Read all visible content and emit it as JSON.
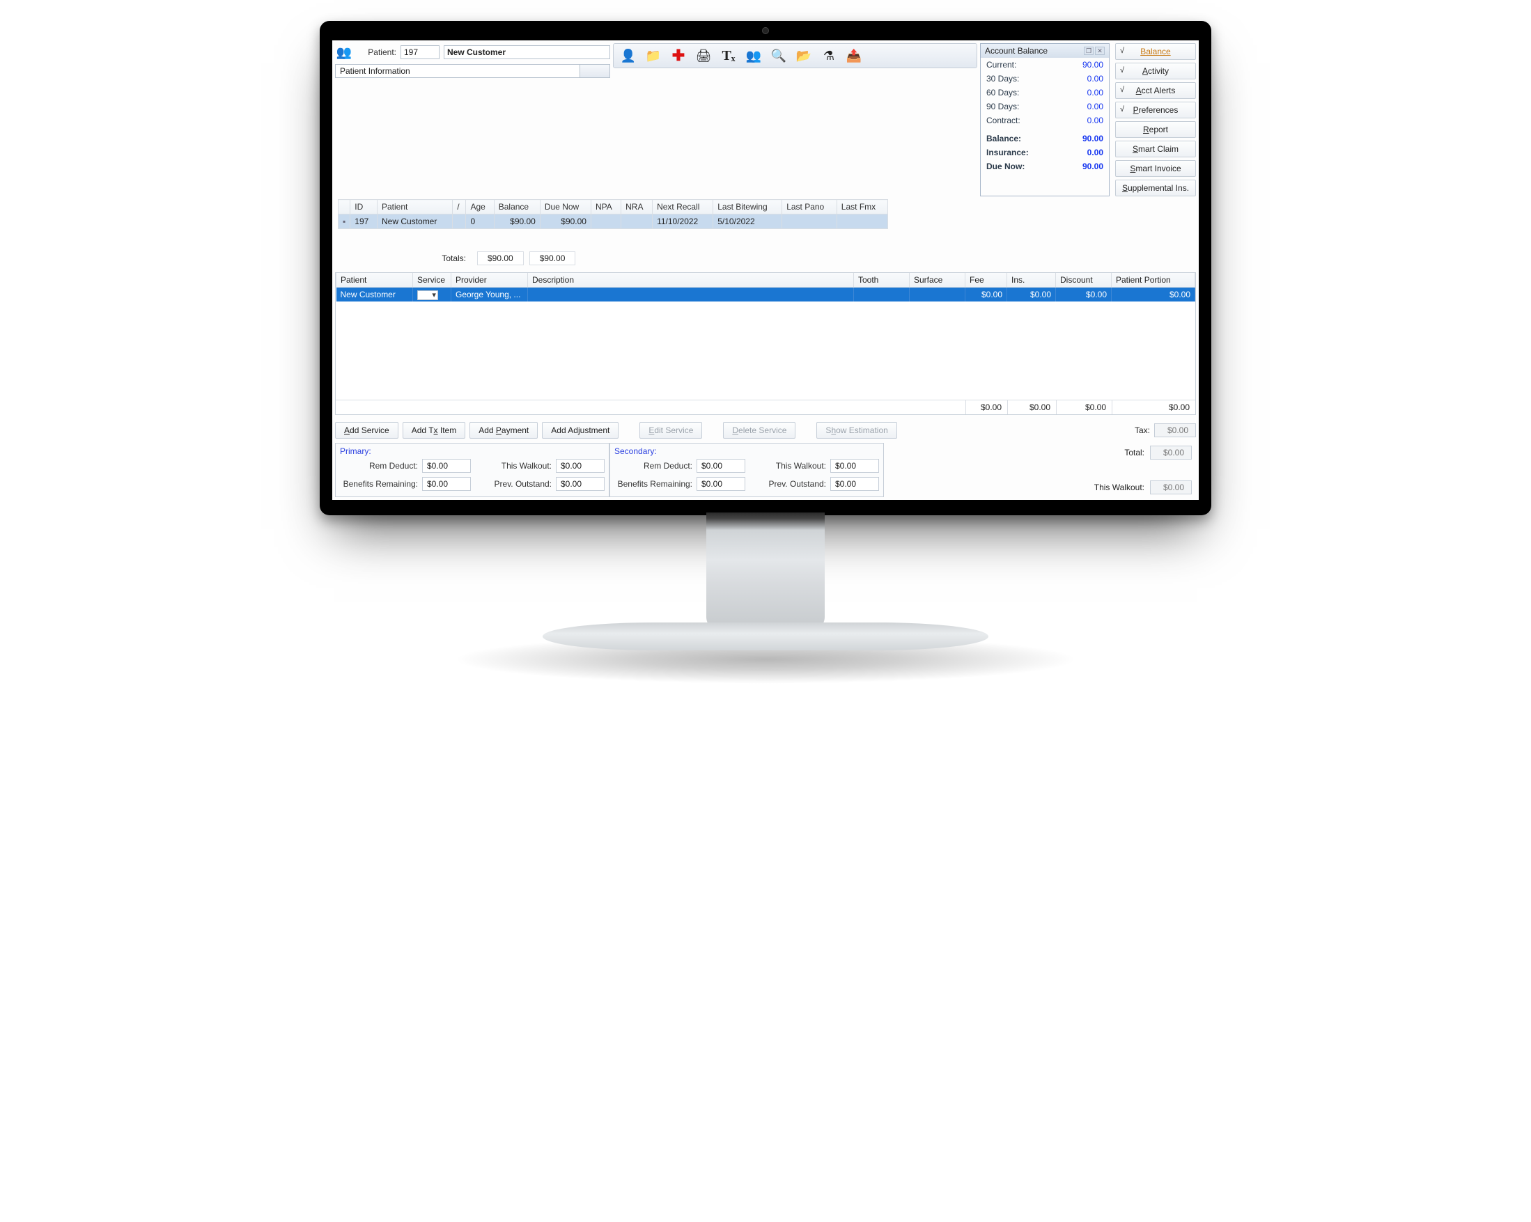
{
  "patient": {
    "label": "Patient:",
    "id": "197",
    "name": "New Customer",
    "info_label": "Patient Information"
  },
  "toolbar_icons": [
    {
      "name": "edit-person-icon",
      "glyph": "👤"
    },
    {
      "name": "folder-icon",
      "glyph": "📁"
    },
    {
      "name": "medical-cross-icon",
      "glyph": "✚"
    },
    {
      "name": "print-icon",
      "glyph": "🖨"
    },
    {
      "name": "tx-icon",
      "glyph": "Tₓ"
    },
    {
      "name": "add-person-icon",
      "glyph": "👥"
    },
    {
      "name": "search-icon",
      "glyph": "🔍"
    },
    {
      "name": "open-folder-icon",
      "glyph": "📂"
    },
    {
      "name": "flask-icon",
      "glyph": "⚗"
    },
    {
      "name": "send-folder-icon",
      "glyph": "📤"
    }
  ],
  "account_balance": {
    "title": "Account Balance",
    "rows": [
      {
        "label": "Current:",
        "value": "90.00"
      },
      {
        "label": "30 Days:",
        "value": "0.00"
      },
      {
        "label": "60 Days:",
        "value": "0.00"
      },
      {
        "label": "90 Days:",
        "value": "0.00"
      },
      {
        "label": "Contract:",
        "value": "0.00"
      }
    ],
    "summary": [
      {
        "label": "Balance:",
        "value": "90.00"
      },
      {
        "label": "Insurance:",
        "value": "0.00"
      },
      {
        "label": "Due Now:",
        "value": "90.00"
      }
    ]
  },
  "side_buttons": [
    {
      "label": "Balance",
      "checked": true,
      "active": true
    },
    {
      "label": "Activity",
      "checked": true
    },
    {
      "label": "Acct Alerts",
      "checked": true
    },
    {
      "label": "Preferences",
      "checked": true
    },
    {
      "label": "Report"
    },
    {
      "label": "Smart Claim"
    },
    {
      "label": "Smart Invoice"
    },
    {
      "label": "Supplemental Ins."
    }
  ],
  "patient_grid": {
    "headers": [
      "",
      "ID",
      "Patient",
      "/",
      "Age",
      "Balance",
      "Due Now",
      "NPA",
      "NRA",
      "Next Recall",
      "Last Bitewing",
      "Last Pano",
      "Last Fmx"
    ],
    "row": {
      "mark": "▪",
      "id": "197",
      "patient": "New Customer",
      "slash": "",
      "age": "0",
      "balance": "$90.00",
      "due_now": "$90.00",
      "npa": "",
      "nra": "",
      "next_recall": "11/10/2022",
      "last_bitewing": "5/10/2022",
      "last_pano": "",
      "last_fmx": ""
    },
    "totals": {
      "label": "Totals:",
      "balance": "$90.00",
      "due_now": "$90.00"
    }
  },
  "service_grid": {
    "headers": [
      "Patient",
      "Service",
      "Provider",
      "Description",
      "Tooth",
      "Surface",
      "Fee",
      "Ins.",
      "Discount",
      "Patient Portion"
    ],
    "row": {
      "patient": "New Customer",
      "service": "",
      "provider": "George Young, ...",
      "description": "",
      "tooth": "",
      "surface": "",
      "fee": "$0.00",
      "ins": "$0.00",
      "discount": "$0.00",
      "portion": "$0.00"
    },
    "footer": {
      "fee": "$0.00",
      "ins": "$0.00",
      "discount": "$0.00",
      "portion": "$0.00"
    }
  },
  "actions": {
    "add_service": "Add Service",
    "add_tx": "Add Tx Item",
    "add_payment": "Add Payment",
    "add_adjustment": "Add Adjustment",
    "edit_service": "Edit Service",
    "delete_service": "Delete Service",
    "show_estimation": "Show Estimation",
    "tax_label": "Tax:",
    "tax_value": "$0.00",
    "total_label": "Total:",
    "total_value": "$0.00",
    "walkout_label": "This Walkout:",
    "walkout_value": "$0.00"
  },
  "insurance": {
    "primary": {
      "title": "Primary:",
      "rem_deduct_l": "Rem Deduct:",
      "rem_deduct": "$0.00",
      "walkout_l": "This Walkout:",
      "walkout": "$0.00",
      "benefits_l": "Benefits Remaining:",
      "benefits": "$0.00",
      "prev_l": "Prev. Outstand:",
      "prev": "$0.00"
    },
    "secondary": {
      "title": "Secondary:",
      "rem_deduct_l": "Rem Deduct:",
      "rem_deduct": "$0.00",
      "walkout_l": "This Walkout:",
      "walkout": "$0.00",
      "benefits_l": "Benefits Remaining:",
      "benefits": "$0.00",
      "prev_l": "Prev. Outstand:",
      "prev": "$0.00"
    }
  }
}
